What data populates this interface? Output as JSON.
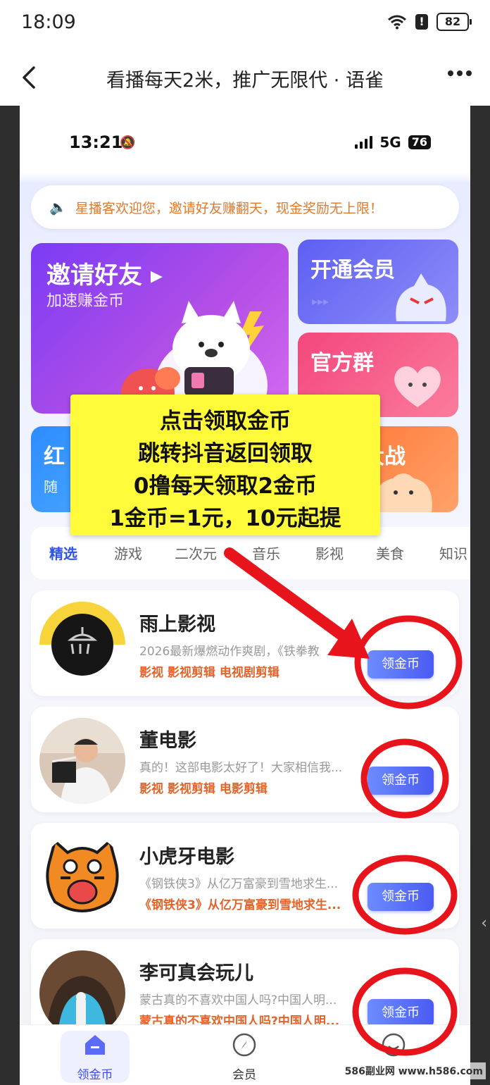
{
  "status_bar": {
    "time": "18:09",
    "battery": "82"
  },
  "nav": {
    "title": "看播每天2米，推广无限代 · 语雀"
  },
  "phone": {
    "time": "13:21",
    "network": "5G",
    "battery": "76",
    "notice": "星播客欢迎您，邀请好友赚翻天，现金奖励无上限！",
    "cards": {
      "invite_title": "邀请好友",
      "invite_sub": "加速赚金币",
      "vip_title": "开通会员",
      "group_title": "官方群",
      "red_title": "红",
      "red_sub": "随",
      "battle_title": "大战"
    },
    "tabs": [
      "精选",
      "游戏",
      "二次元",
      "音乐",
      "影视",
      "美食",
      "知识"
    ],
    "items": [
      {
        "name": "雨上影视",
        "desc": "2026最新爆燃动作爽剧，《铁拳教",
        "tags": "影视  影视剪辑  电视剧剪辑",
        "button": "领金币"
      },
      {
        "name": "董电影",
        "desc": "真的！这部电影太好了！大家相信我...",
        "tags": "影视  影视剪辑  电影剪辑",
        "button": "领金币"
      },
      {
        "name": "小虎牙电影",
        "desc": "《钢铁侠3》从亿万富豪到雪地求生...",
        "tags": "《钢铁侠3》从亿万富豪到雪地求生...",
        "button": "领金币"
      },
      {
        "name": "李可真会玩儿",
        "desc": "蒙古真的不喜欢中国人吗?中国人明...",
        "tags": "蒙古真的不喜欢中国人吗?中国人明...",
        "button": "领金币"
      }
    ],
    "bottom_nav": [
      "领金币",
      "会员",
      ""
    ]
  },
  "overlay": {
    "line1": "点击领取金币",
    "line2": "跳转抖音返回领取",
    "line3": "0撸每天领取2金币",
    "line4": "1金币=1元，10元起提"
  },
  "watermark": "586副业网 www.h586.com",
  "colors": {
    "annotation": "#e8141c",
    "overlay_bg": "#fffb3a",
    "accent": "#2f54eb",
    "tag": "#e3642a"
  }
}
